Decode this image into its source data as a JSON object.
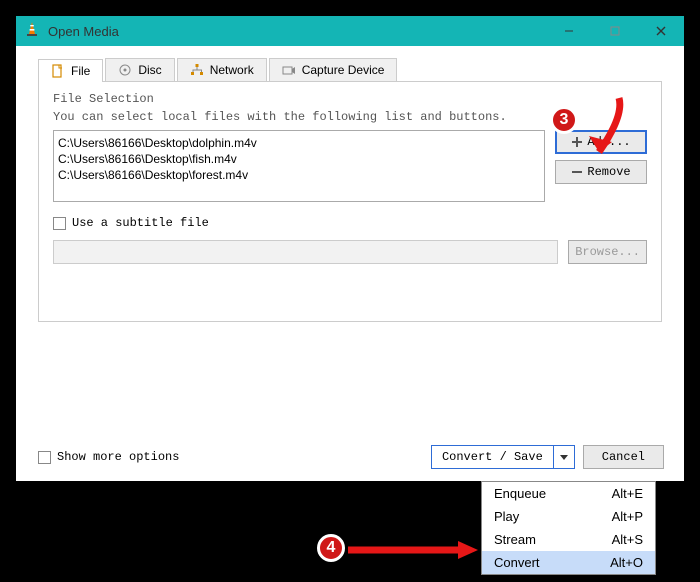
{
  "window": {
    "title": "Open Media"
  },
  "tabs": {
    "file": "File",
    "disc": "Disc",
    "network": "Network",
    "capture": "Capture Device"
  },
  "file_panel": {
    "section_title": "File Selection",
    "hint": "You can select local files with the following list and buttons.",
    "files": [
      "C:\\Users\\86166\\Desktop\\dolphin.m4v",
      "C:\\Users\\86166\\Desktop\\fish.m4v",
      "C:\\Users\\86166\\Desktop\\forest.m4v"
    ],
    "add_label": "Add...",
    "remove_label": "Remove",
    "subtitle_label": "Use a subtitle file",
    "browse_label": "Browse..."
  },
  "footer": {
    "show_more": "Show more options",
    "convert_save": "Convert / Save",
    "cancel": "Cancel"
  },
  "dropdown": {
    "items": [
      {
        "label": "Enqueue",
        "shortcut": "Alt+E"
      },
      {
        "label": "Play",
        "shortcut": "Alt+P"
      },
      {
        "label": "Stream",
        "shortcut": "Alt+S"
      },
      {
        "label": "Convert",
        "shortcut": "Alt+O"
      }
    ],
    "selected_index": 3
  },
  "annotations": {
    "badge3": "3",
    "badge4": "4"
  }
}
